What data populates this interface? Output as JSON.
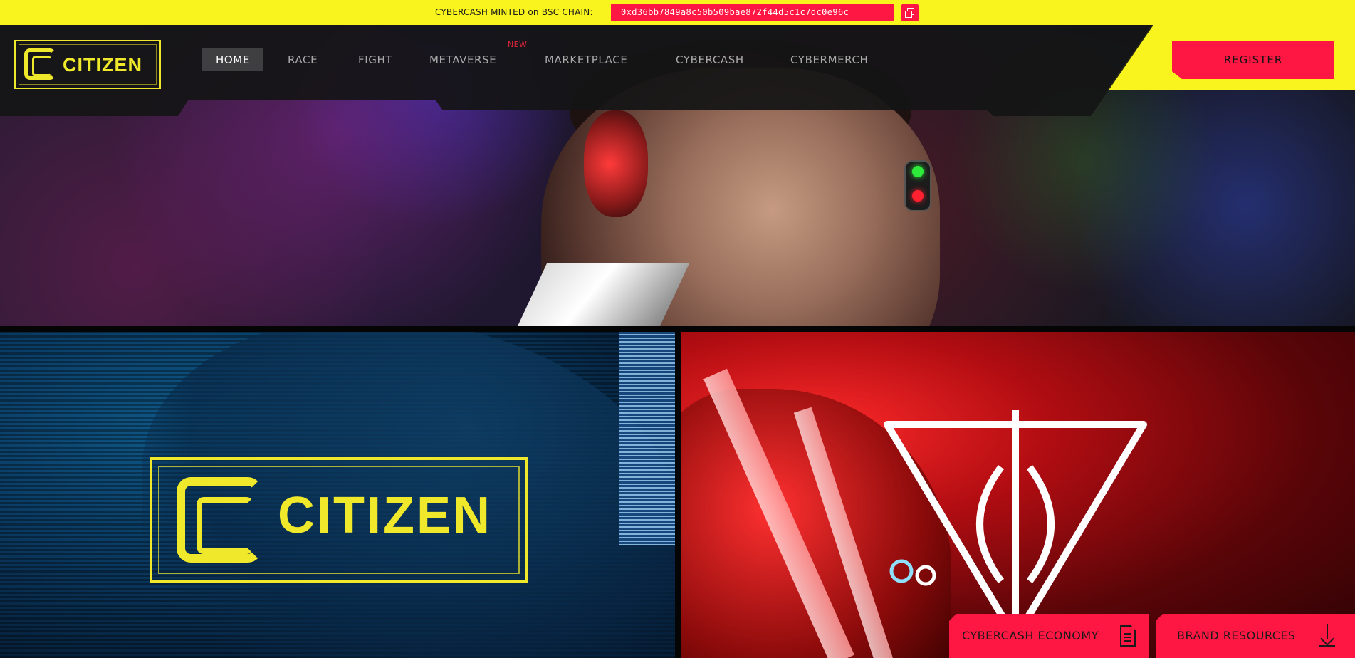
{
  "ticker": {
    "label": "CYBERCASH MINTED on BSC CHAIN:",
    "contract_address": "0xd36bb7849a8c50b509bae872f44d5c1c7dc0e96c",
    "copy_icon": "copy-icon"
  },
  "brand": {
    "logo_text": "CITIZEN"
  },
  "nav": {
    "items": [
      {
        "label": "HOME",
        "active": true
      },
      {
        "label": "RACE"
      },
      {
        "label": "FIGHT"
      },
      {
        "label": "METAVERSE",
        "badge": "NEW"
      },
      {
        "label": "MARKETPLACE"
      },
      {
        "label": "CYBERCASH"
      },
      {
        "label": "CYBERMERCH"
      }
    ],
    "register_label": "REGISTER"
  },
  "panels": {
    "left_logo_text": "CITIZEN"
  },
  "buttons": {
    "economy_label": "CYBERCASH ECONOMY",
    "economy_icon": "document-icon",
    "brand_label": "BRAND RESOURCES",
    "brand_icon": "download-icon"
  },
  "colors": {
    "accent_yellow": "#f9f41d",
    "accent_red": "#ff1744",
    "nav_bg": "#141416"
  }
}
